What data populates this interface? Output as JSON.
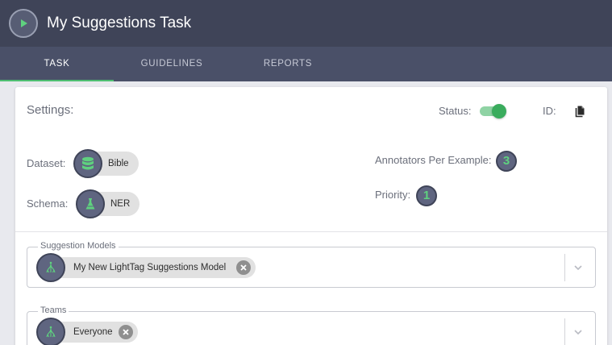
{
  "app": {
    "title": "My Suggestions Task"
  },
  "tabs": [
    {
      "label": "TASK",
      "active": true
    },
    {
      "label": "GUIDELINES",
      "active": false
    },
    {
      "label": "REPORTS",
      "active": false
    }
  ],
  "settings": {
    "heading": "Settings:",
    "status_label": "Status:",
    "status_on": true,
    "id_label": "ID:",
    "dataset_label": "Dataset:",
    "dataset_value": "Bible",
    "schema_label": "Schema:",
    "schema_value": "NER",
    "annotators_label": "Annotators Per Example:",
    "annotators_value": "3",
    "priority_label": "Priority:",
    "priority_value": "1"
  },
  "suggestion_models": {
    "legend": "Suggestion Models",
    "selected": [
      "My New LightTag Suggestions Model"
    ]
  },
  "teams": {
    "legend": "Teams",
    "selected": [
      "Everyone"
    ]
  },
  "colors": {
    "header": "#3f4458",
    "tabbar": "#4a5068",
    "accent_green": "#4fbf72",
    "badge": "#5f6580"
  },
  "icons": {
    "play": "play-icon",
    "copy": "copy-icon",
    "dataset": "database-icon",
    "schema": "flask-icon",
    "model": "network-icon",
    "remove": "close-circle-icon",
    "dropdown": "chevron-down-icon"
  }
}
